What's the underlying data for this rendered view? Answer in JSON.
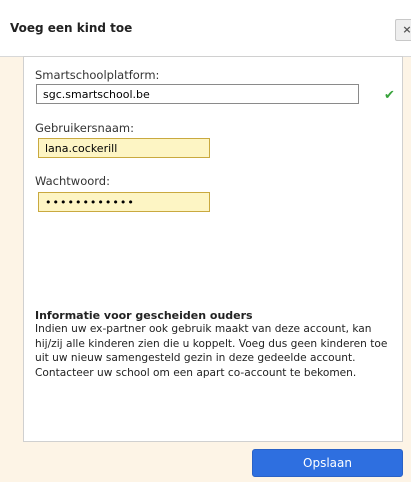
{
  "dialog": {
    "title": "Voeg een kind toe",
    "close_label": "×"
  },
  "form": {
    "platform_label": "Smartschoolplatform:",
    "platform_value": "sgc.smartschool.be",
    "platform_valid_icon": "checkmark-icon",
    "platform_valid_glyph": "✔",
    "username_label": "Gebruikersnaam:",
    "username_value": "lana.cockerill",
    "password_label": "Wachtwoord:",
    "password_value": "••••••••••••"
  },
  "info": {
    "title": "Informatie voor gescheiden ouders",
    "text": "Indien uw ex-partner ook gebruik maakt van deze account, kan hij/zij alle kinderen zien die u koppelt. Voeg dus geen kinderen toe uit uw nieuw samengesteld gezin in deze gedeelde account. Contacteer uw school om een apart co-account te bekomen."
  },
  "actions": {
    "save_label": "Opslaan"
  },
  "colors": {
    "background": "#fdf4e6",
    "accent": "#2e6fe0",
    "success": "#37a33b",
    "autofill": "#fdf5c4"
  }
}
